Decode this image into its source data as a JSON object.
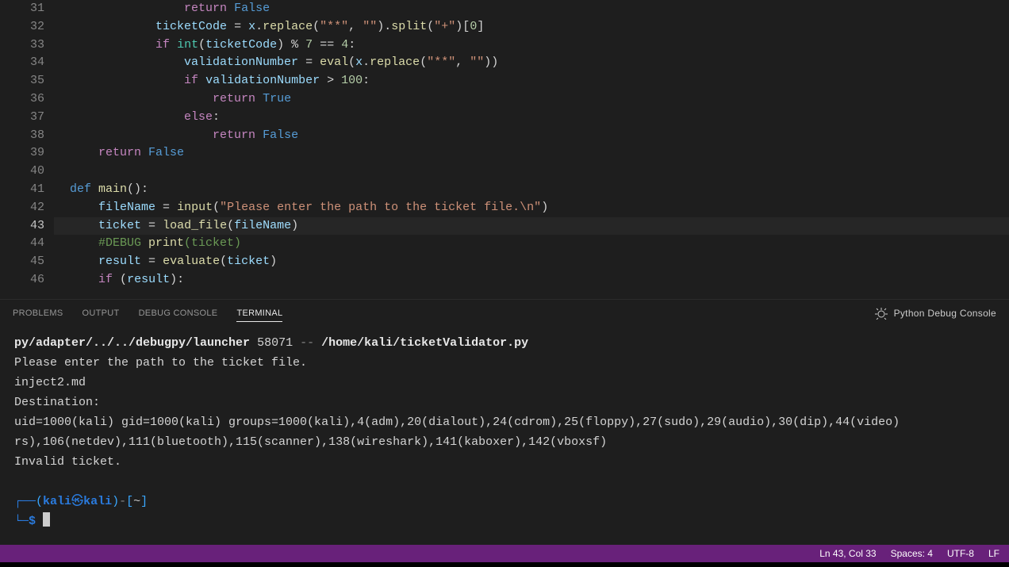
{
  "editor": {
    "highlighted_line": 43,
    "lines": [
      {
        "n": 31,
        "html": "                <span class='kw'>return</span> <span class='cst'>False</span>"
      },
      {
        "n": 32,
        "html": "            <span class='id'>ticketCode</span> <span class='op'>=</span> <span class='id'>x</span><span class='pun'>.</span><span class='fn'>replace</span><span class='pun'>(</span><span class='str'>\"**\"</span><span class='pun'>,</span> <span class='str'>\"\"</span><span class='pun'>)</span><span class='pun'>.</span><span class='fn'>split</span><span class='pun'>(</span><span class='str'>\"+\"</span><span class='pun'>)[</span><span class='num'>0</span><span class='pun'>]</span>"
      },
      {
        "n": 33,
        "html": "            <span class='kw'>if</span> <span class='ty'>int</span><span class='pun'>(</span><span class='id'>ticketCode</span><span class='pun'>)</span> <span class='op'>%</span> <span class='num'>7</span> <span class='op'>==</span> <span class='num'>4</span><span class='pun'>:</span>"
      },
      {
        "n": 34,
        "html": "                <span class='id'>validationNumber</span> <span class='op'>=</span> <span class='bi'>eval</span><span class='pun'>(</span><span class='id'>x</span><span class='pun'>.</span><span class='fn'>replace</span><span class='pun'>(</span><span class='str'>\"**\"</span><span class='pun'>,</span> <span class='str'>\"\"</span><span class='pun'>))</span>"
      },
      {
        "n": 35,
        "html": "                <span class='kw'>if</span> <span class='id'>validationNumber</span> <span class='op'>&gt;</span> <span class='num'>100</span><span class='pun'>:</span>"
      },
      {
        "n": 36,
        "html": "                    <span class='kw'>return</span> <span class='cst'>True</span>"
      },
      {
        "n": 37,
        "html": "                <span class='kw'>else</span><span class='pun'>:</span>"
      },
      {
        "n": 38,
        "html": "                    <span class='kw'>return</span> <span class='cst'>False</span>"
      },
      {
        "n": 39,
        "html": "    <span class='kw'>return</span> <span class='cst'>False</span>"
      },
      {
        "n": 40,
        "html": ""
      },
      {
        "n": 41,
        "html": "<span class='cst'>def</span> <span class='fn'>main</span><span class='pun'>():</span>"
      },
      {
        "n": 42,
        "html": "    <span class='id'>fileName</span> <span class='op'>=</span> <span class='bi'>input</span><span class='pun'>(</span><span class='str'>\"Please enter the path to the ticket file.\\n\"</span><span class='pun'>)</span>"
      },
      {
        "n": 43,
        "html": "    <span class='id'>ticket</span> <span class='op'>=</span> <span class='fn'>load_file</span><span class='pun'>(</span><span class='id'>fileName</span><span class='pun'>)</span>"
      },
      {
        "n": 44,
        "html": "    <span class='cmt'>#DEBUG <span class='fn2'>print</span>(ticket)</span>"
      },
      {
        "n": 45,
        "html": "    <span class='id'>result</span> <span class='op'>=</span> <span class='fn'>evaluate</span><span class='pun'>(</span><span class='id'>ticket</span><span class='pun'>)</span>"
      },
      {
        "n": 46,
        "html": "    <span class='kw'>if</span> <span class='pun'>(</span><span class='id'>result</span><span class='pun'>):</span>"
      }
    ]
  },
  "panel": {
    "tabs": {
      "problems": "PROBLEMS",
      "output": "OUTPUT",
      "debug": "DEBUG CONSOLE",
      "terminal": "TERMINAL"
    },
    "active": "terminal",
    "console_label": "Python Debug Console"
  },
  "terminal": {
    "cmd_prefix": "py/adapter/../../debugpy/launcher",
    "port": "58071",
    "dash": "--",
    "script_path": "/home/kali/ticketValidator.py",
    "line_prompt": "Please enter the path to the ticket file.",
    "line_input": "inject2.md",
    "line_dest": "Destination:",
    "line_id1": "uid=1000(kali) gid=1000(kali) groups=1000(kali),4(adm),20(dialout),24(cdrom),25(floppy),27(sudo),29(audio),30(dip),44(video)",
    "line_id2": "rs),106(netdev),111(bluetooth),115(scanner),138(wireshark),141(kaboxer),142(vboxsf)",
    "line_invalid": "Invalid ticket.",
    "prompt": {
      "user": "kali",
      "host": "kali",
      "cwd": "~",
      "symbol": "$"
    }
  },
  "statusbar": {
    "ln_col": "Ln 43, Col 33",
    "spaces": "Spaces: 4",
    "encoding": "UTF-8",
    "eol": "LF"
  }
}
